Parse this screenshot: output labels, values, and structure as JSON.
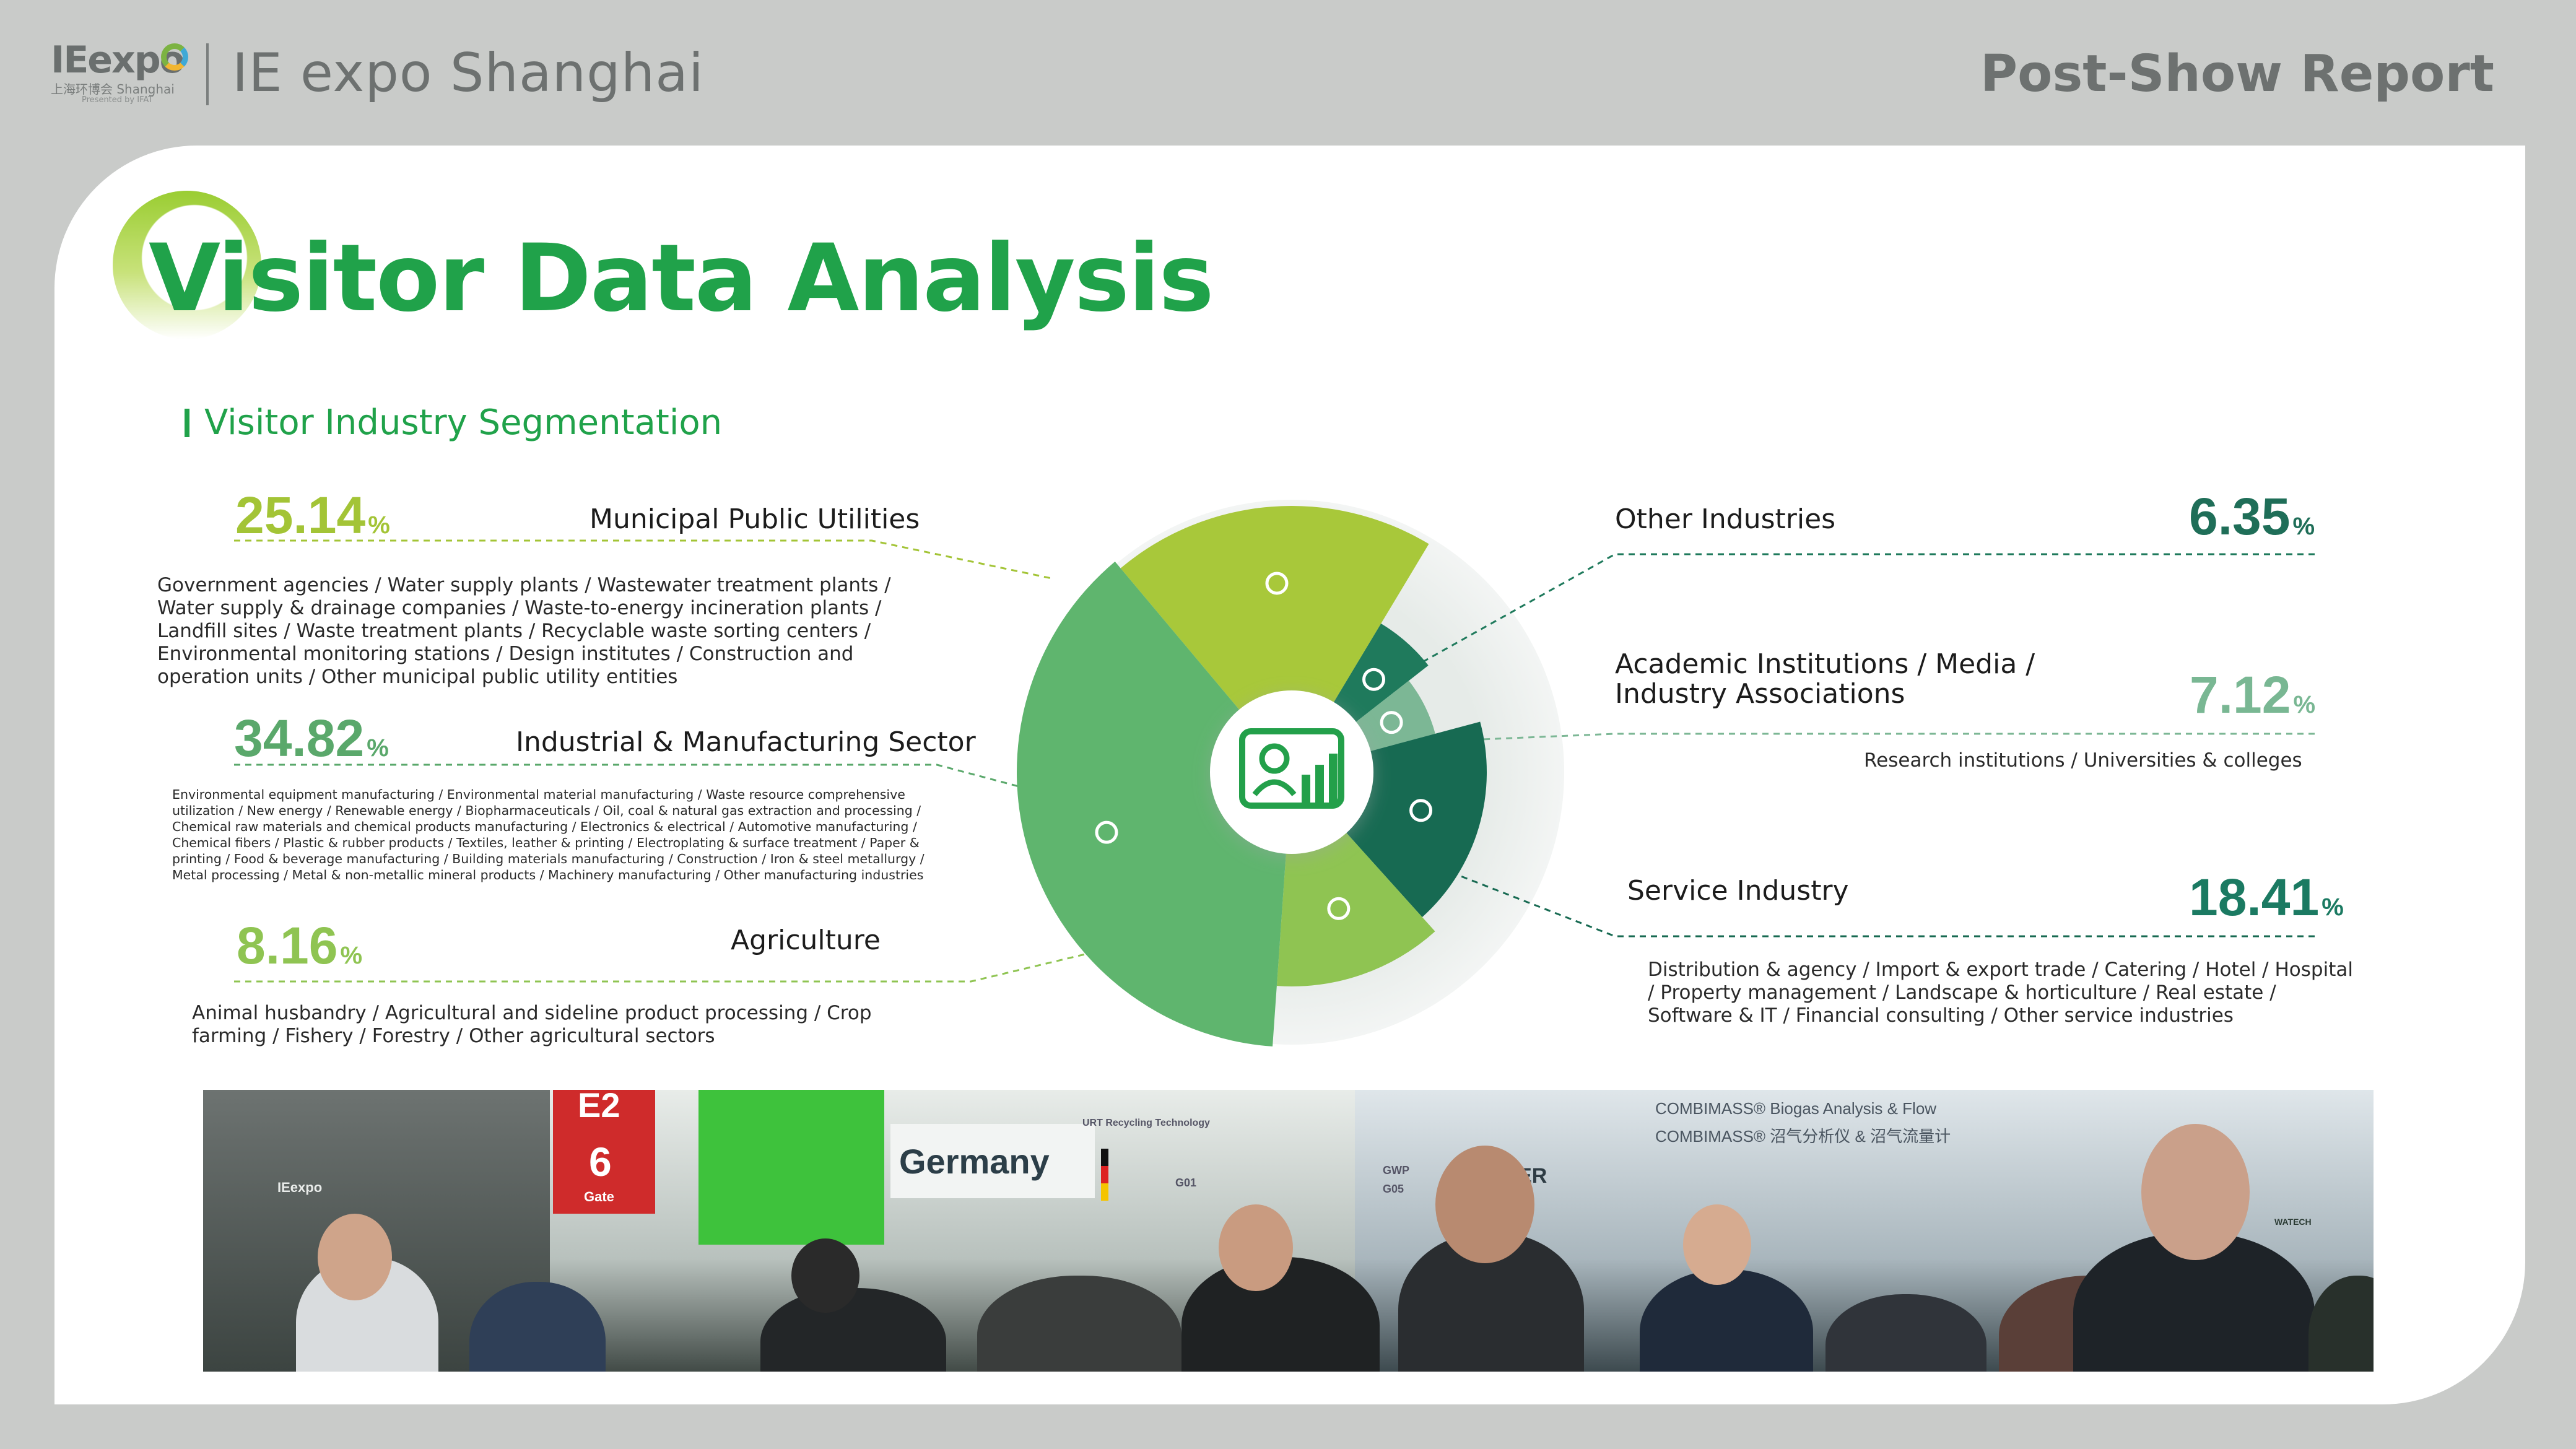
{
  "header": {
    "logo_text": "IEexpo",
    "logo_sub": "上海环博会 Shanghai",
    "logo_presented": "Presented by IFAT",
    "brand_title": "IE expo Shanghai",
    "report_label": "Post-Show Report"
  },
  "page": {
    "title": "Visitor Data Analysis",
    "section_title": "Visitor Industry Segmentation"
  },
  "segments": {
    "municipal": {
      "pct": "25.14",
      "sign": "%",
      "label": "Municipal Public Utilities",
      "desc": "Government agencies / Water supply plants / Wastewater treatment plants / Water supply & drainage companies / Waste-to-energy incineration plants / Landfill sites / Waste treatment plants / Recyclable waste sorting centers / Environmental monitoring stations / Design institutes / Construction and operation units / Other municipal public utility entities"
    },
    "industrial": {
      "pct": "34.82",
      "sign": "%",
      "label": "Industrial & Manufacturing Sector",
      "desc": "Environmental equipment manufacturing / Environmental material manufacturing / Waste resource comprehensive utilization / New energy / Renewable energy / Biopharmaceuticals / Oil, coal & natural gas extraction and processing / Chemical raw materials and chemical products manufacturing / Electronics & electrical / Automotive manufacturing / Chemical fibers / Plastic & rubber products / Textiles, leather & printing / Electroplating & surface treatment / Paper & printing / Food & beverage manufacturing / Building materials manufacturing / Construction / Iron & steel metallurgy / Metal processing / Metal & non-metallic mineral products / Machinery manufacturing / Other manufacturing industries"
    },
    "agriculture": {
      "pct": "8.16",
      "sign": "%",
      "label": "Agriculture",
      "desc": "Animal husbandry / Agricultural and sideline product processing / Crop farming / Fishery / Forestry / Other agricultural sectors"
    },
    "other": {
      "pct": "6.35",
      "sign": "%",
      "label": "Other Industries"
    },
    "academic": {
      "pct": "7.12",
      "sign": "%",
      "label_line1": "Academic Institutions / Media /",
      "label_line2": "Industry Associations",
      "desc": "Research institutions / Universities & colleges"
    },
    "service": {
      "pct": "18.41",
      "sign": "%",
      "label": "Service Industry",
      "desc": "Distribution & agency / Import & export trade / Catering / Hotel / Hospital / Property management / Landscape & horticulture / Real estate / Software & IT / Financial consulting / Other service industries"
    }
  },
  "chart_data": {
    "type": "pie",
    "variant": "radial (nightingale) pie with center icon",
    "categories": [
      "Municipal Public Utilities",
      "Other Industries",
      "Academic Institutions / Media / Industry Associations",
      "Service Industry",
      "Agriculture",
      "Industrial & Manufacturing Sector"
    ],
    "values": [
      25.14,
      6.35,
      7.12,
      18.41,
      8.16,
      34.82
    ],
    "unit": "%",
    "colors": [
      "#a8c83a",
      "#1f7a5c",
      "#7cb795",
      "#176a52",
      "#8fc452",
      "#5fb56e"
    ],
    "center_icon": "dashboard-icon"
  },
  "photo": {
    "signs": {
      "hall_code": "E2",
      "gate_num": "6",
      "gate_label": "Gate",
      "country": "Germany",
      "booth_left": "URT Recycling Technology",
      "booth_g01": "G01",
      "gwp": "GWP",
      "g05": "G05",
      "binder": "BINDER",
      "combimass1": "COMBIMASS® Biogas Analysis & Flow",
      "combimass2": "COMBIMASS® 沼气分析仪 & 沼气流量计",
      "ieexpo_small": "IEexpo",
      "watech": "WATECH"
    }
  }
}
